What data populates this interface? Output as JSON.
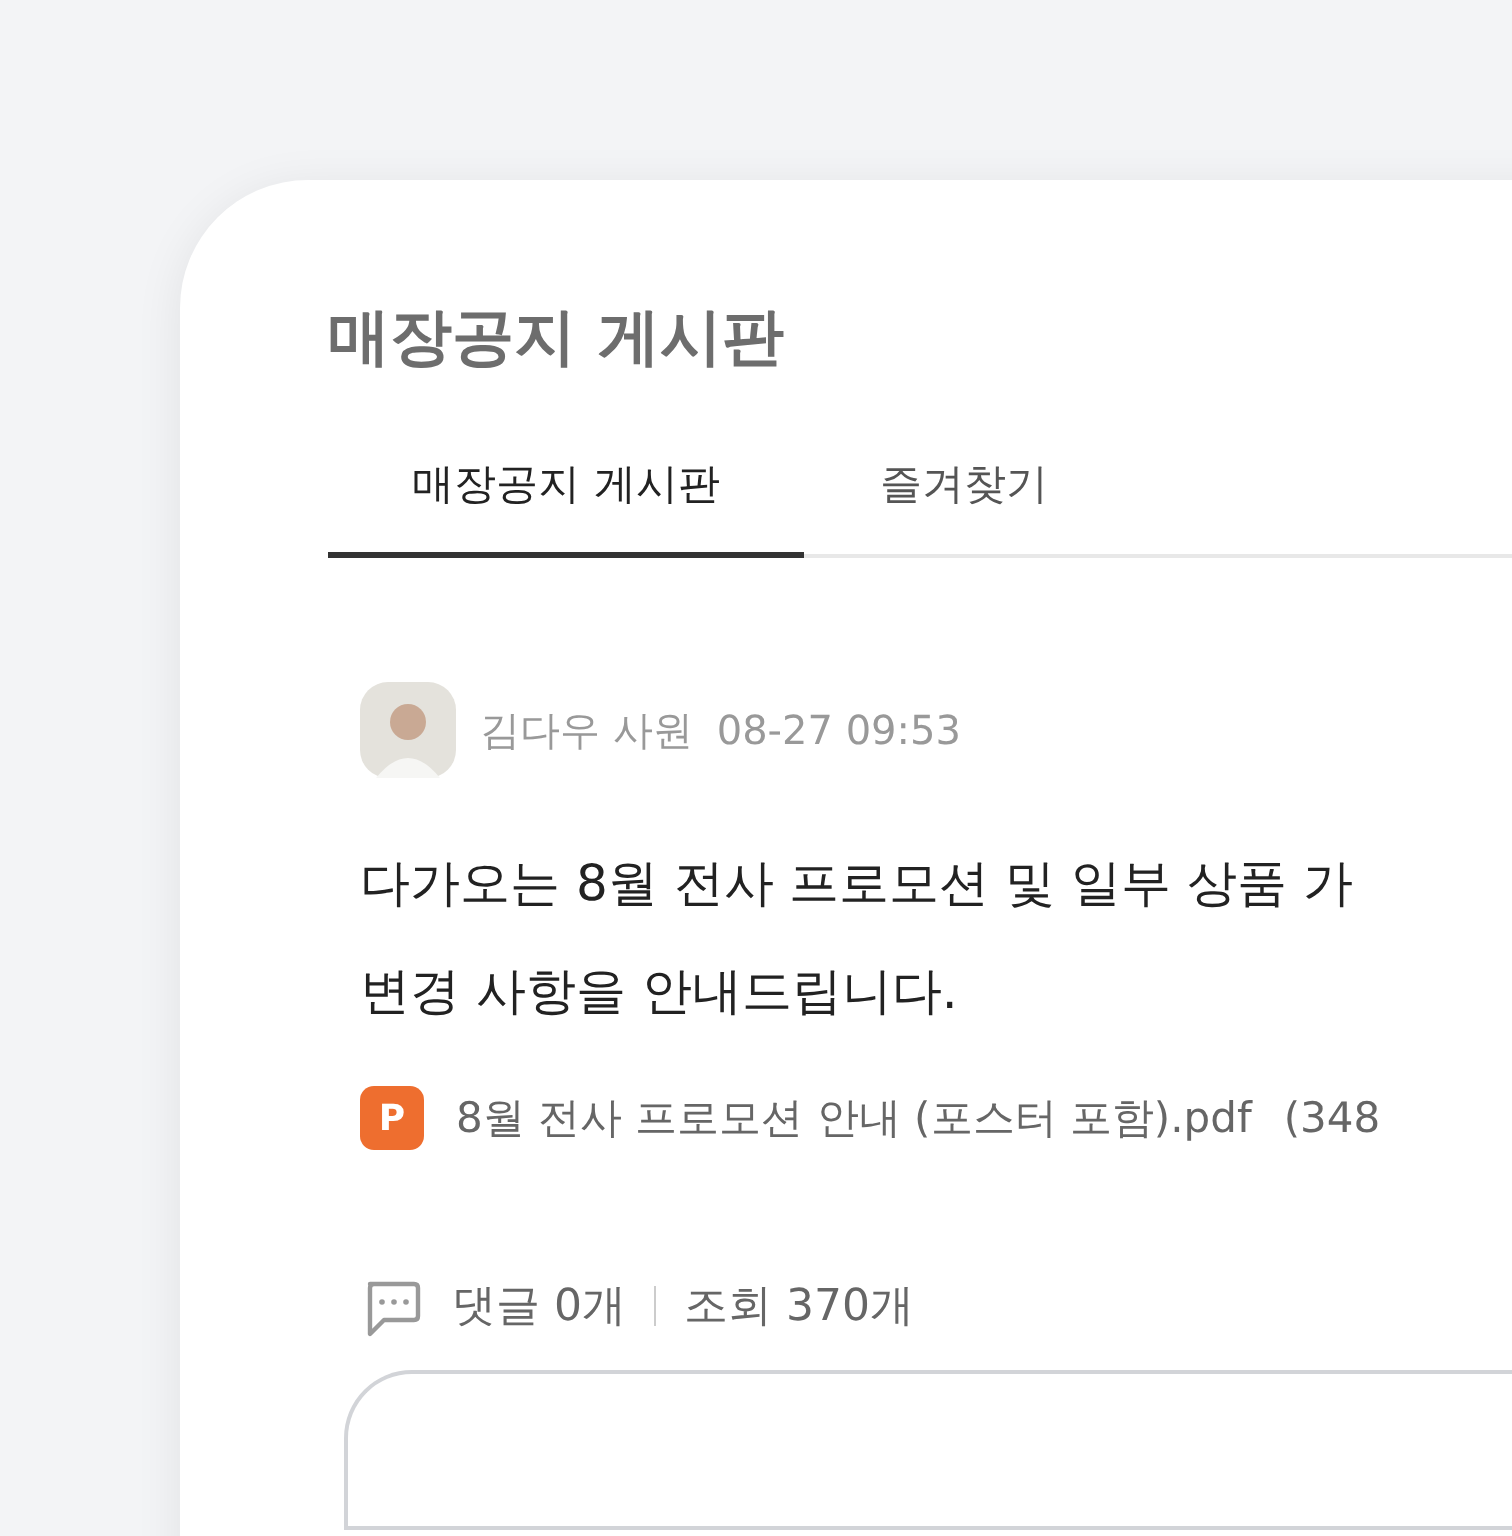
{
  "board": {
    "title": "매장공지 게시판",
    "tabs": [
      {
        "label": "매장공지 게시판",
        "selected": true
      },
      {
        "label": "즐겨찾기",
        "selected": false
      }
    ],
    "post": {
      "author": "김다우 사원",
      "time": "08-27 09:53",
      "body": [
        "다가오는 8월 전사 프로모션 및 일부 상품 가",
        "변경 사항을 안내드립니다."
      ],
      "attachment": {
        "badge": "P",
        "name": "8월 전사 프로모션 안내 (포스터 포함).pdf",
        "size": "(348"
      },
      "comments": "댓글 0개",
      "views": "조회 370개"
    }
  }
}
